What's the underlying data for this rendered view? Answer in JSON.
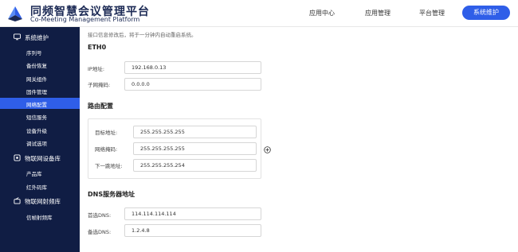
{
  "app": {
    "title_cn": "同频智慧会议管理平台",
    "title_en": "Co-Meeting Management Platform",
    "logo_icon": "logo-icon"
  },
  "top_nav": {
    "items": [
      {
        "label": "应用中心"
      },
      {
        "label": "应用管理"
      },
      {
        "label": "平台管理"
      },
      {
        "label": "系统维护",
        "active": true
      }
    ],
    "accent_color": "#2f5ee8"
  },
  "sidebar": {
    "background": "#101d44",
    "groups": [
      {
        "label": "系统维护",
        "icon": "monitor-icon",
        "items": [
          {
            "label": "序列号"
          },
          {
            "label": "备份恢复"
          },
          {
            "label": "网关组件"
          },
          {
            "label": "固件管理"
          },
          {
            "label": "网络配置",
            "active": true
          },
          {
            "label": "短信服务"
          },
          {
            "label": "设备升级"
          },
          {
            "label": "调试选项"
          }
        ]
      },
      {
        "label": "物联网设备库",
        "icon": "device-icon",
        "items": [
          {
            "label": "产品库"
          },
          {
            "label": "红外码库"
          }
        ]
      },
      {
        "label": "物联网射频库",
        "icon": "radio-icon",
        "items": [
          {
            "label": "信帧射频库"
          }
        ]
      }
    ]
  },
  "main": {
    "notice": "接口信息修改后，将于一分钟内自动重启系统。",
    "eth0": {
      "title": "ETH0",
      "ip_label": "IP地址:",
      "ip_value": "192.168.0.13",
      "mask_label": "子网掩码:",
      "mask_value": "0.0.0.0"
    },
    "route": {
      "title": "路由配置",
      "target_label": "目标地址:",
      "target_value": "255.255.255.255",
      "mask_label": "网络掩码:",
      "mask_value": "255.255.255.255",
      "nexthop_label": "下一跳地址:",
      "nexthop_value": "255.255.255.254",
      "add_icon": "plus-circle-icon"
    },
    "dns": {
      "title": "DNS服务器地址",
      "primary_label": "首选DNS:",
      "primary_value": "114.114.114.114",
      "backup_label": "备选DNS:",
      "backup_value": "1.2.4.8"
    }
  }
}
